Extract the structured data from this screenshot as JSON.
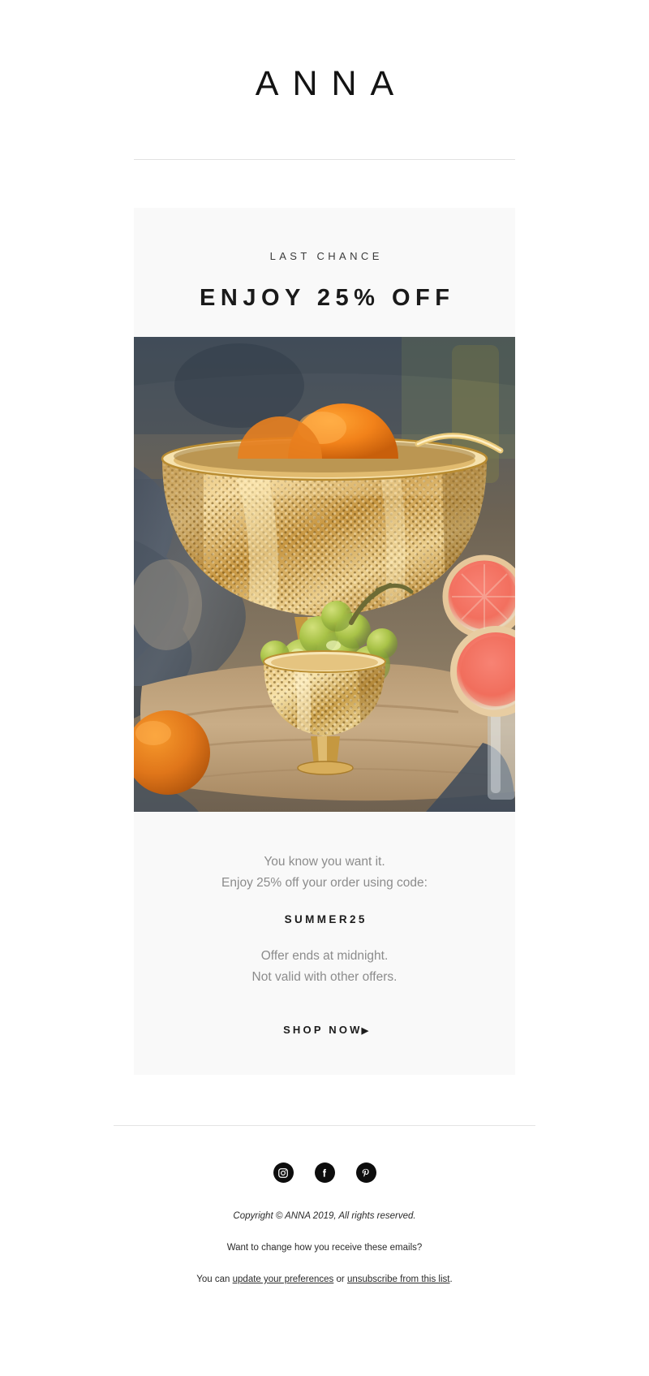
{
  "header": {
    "logo": "ANNA"
  },
  "hero": {
    "eyebrow": "LAST CHANCE",
    "headline": "ENJOY 25% OFF",
    "image_alt": "Gold perforated fruit bowls holding oranges and green grapes on a wooden table",
    "body_line_1": "You know you want it.",
    "body_line_2": "Enjoy 25% off your order using code:",
    "promo_code": "SUMMER25",
    "terms_line_1": "Offer ends at midnight.",
    "terms_line_2": "Not valid with other offers.",
    "cta_label": "SHOP NOW",
    "cta_arrow": "▶"
  },
  "footer": {
    "social": [
      {
        "name": "instagram",
        "label": "Instagram"
      },
      {
        "name": "facebook",
        "label": "Facebook"
      },
      {
        "name": "pinterest",
        "label": "Pinterest"
      }
    ],
    "copyright": "Copyright © ANNA 2019, All rights reserved.",
    "question": "Want to change how you receive these emails?",
    "links_prefix": "You can ",
    "link_preferences": "update your preferences",
    "links_middle": " or ",
    "link_unsubscribe": "unsubscribe from this list",
    "links_suffix": "."
  },
  "colors": {
    "background": "#ffffff",
    "card": "#f9f9f9",
    "text_dark": "#1a1a1a",
    "text_muted": "#8c8c8c",
    "rule": "#e2e2e2",
    "social_bg": "#0d0d0d"
  }
}
